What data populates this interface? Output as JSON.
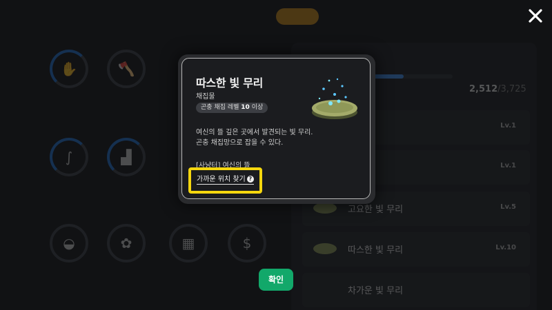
{
  "colors": {
    "accent_yellow": "#f5d70e",
    "confirm_green": "#12a86a",
    "progress_blue": "#3d8ff0"
  },
  "background": {
    "tabs": [
      {
        "label": ""
      },
      {
        "label": ""
      },
      {
        "label": "",
        "active": true
      },
      {
        "label": ""
      }
    ],
    "skill_icons": [
      "harvest-icon",
      "axe-icon",
      "fishing-rod-icon",
      "anvil-icon",
      "cooking-pot-icon",
      "plant-icon",
      "boxes-icon",
      "money-bag-icon"
    ],
    "collection": {
      "counter_value": "2,512",
      "counter_total": "/3,725",
      "progress_fraction": 0.674,
      "rows": [
        {
          "name": "",
          "level": "Lv.1"
        },
        {
          "name": "무리",
          "level": "Lv.1"
        },
        {
          "name": "고요한 빛 무리",
          "level": "Lv.5"
        },
        {
          "name": "따스한 빛 무리",
          "level": "Lv.10"
        },
        {
          "name": "차가운 빛 무리",
          "level": ""
        }
      ]
    }
  },
  "popup": {
    "title": "따스한 빛 무리",
    "type": "채집물",
    "requirement_prefix": "곤충 채집 레벨",
    "requirement_level": "10",
    "requirement_suffix": "이상",
    "description_line1": "여신의 뜰 깊은 곳에서 발견되는 빛 무리.",
    "description_line2": "곤충 채집망으로 잡을 수 있다.",
    "location": "[사냥터] 여신의 뜰",
    "find_button_label": "가까운 위치 찾기",
    "help_icon": "question-circle-icon",
    "item_art": "glowing-firefly-swarm-icon"
  },
  "confirm_label": "확인",
  "close_icon": "close-icon"
}
